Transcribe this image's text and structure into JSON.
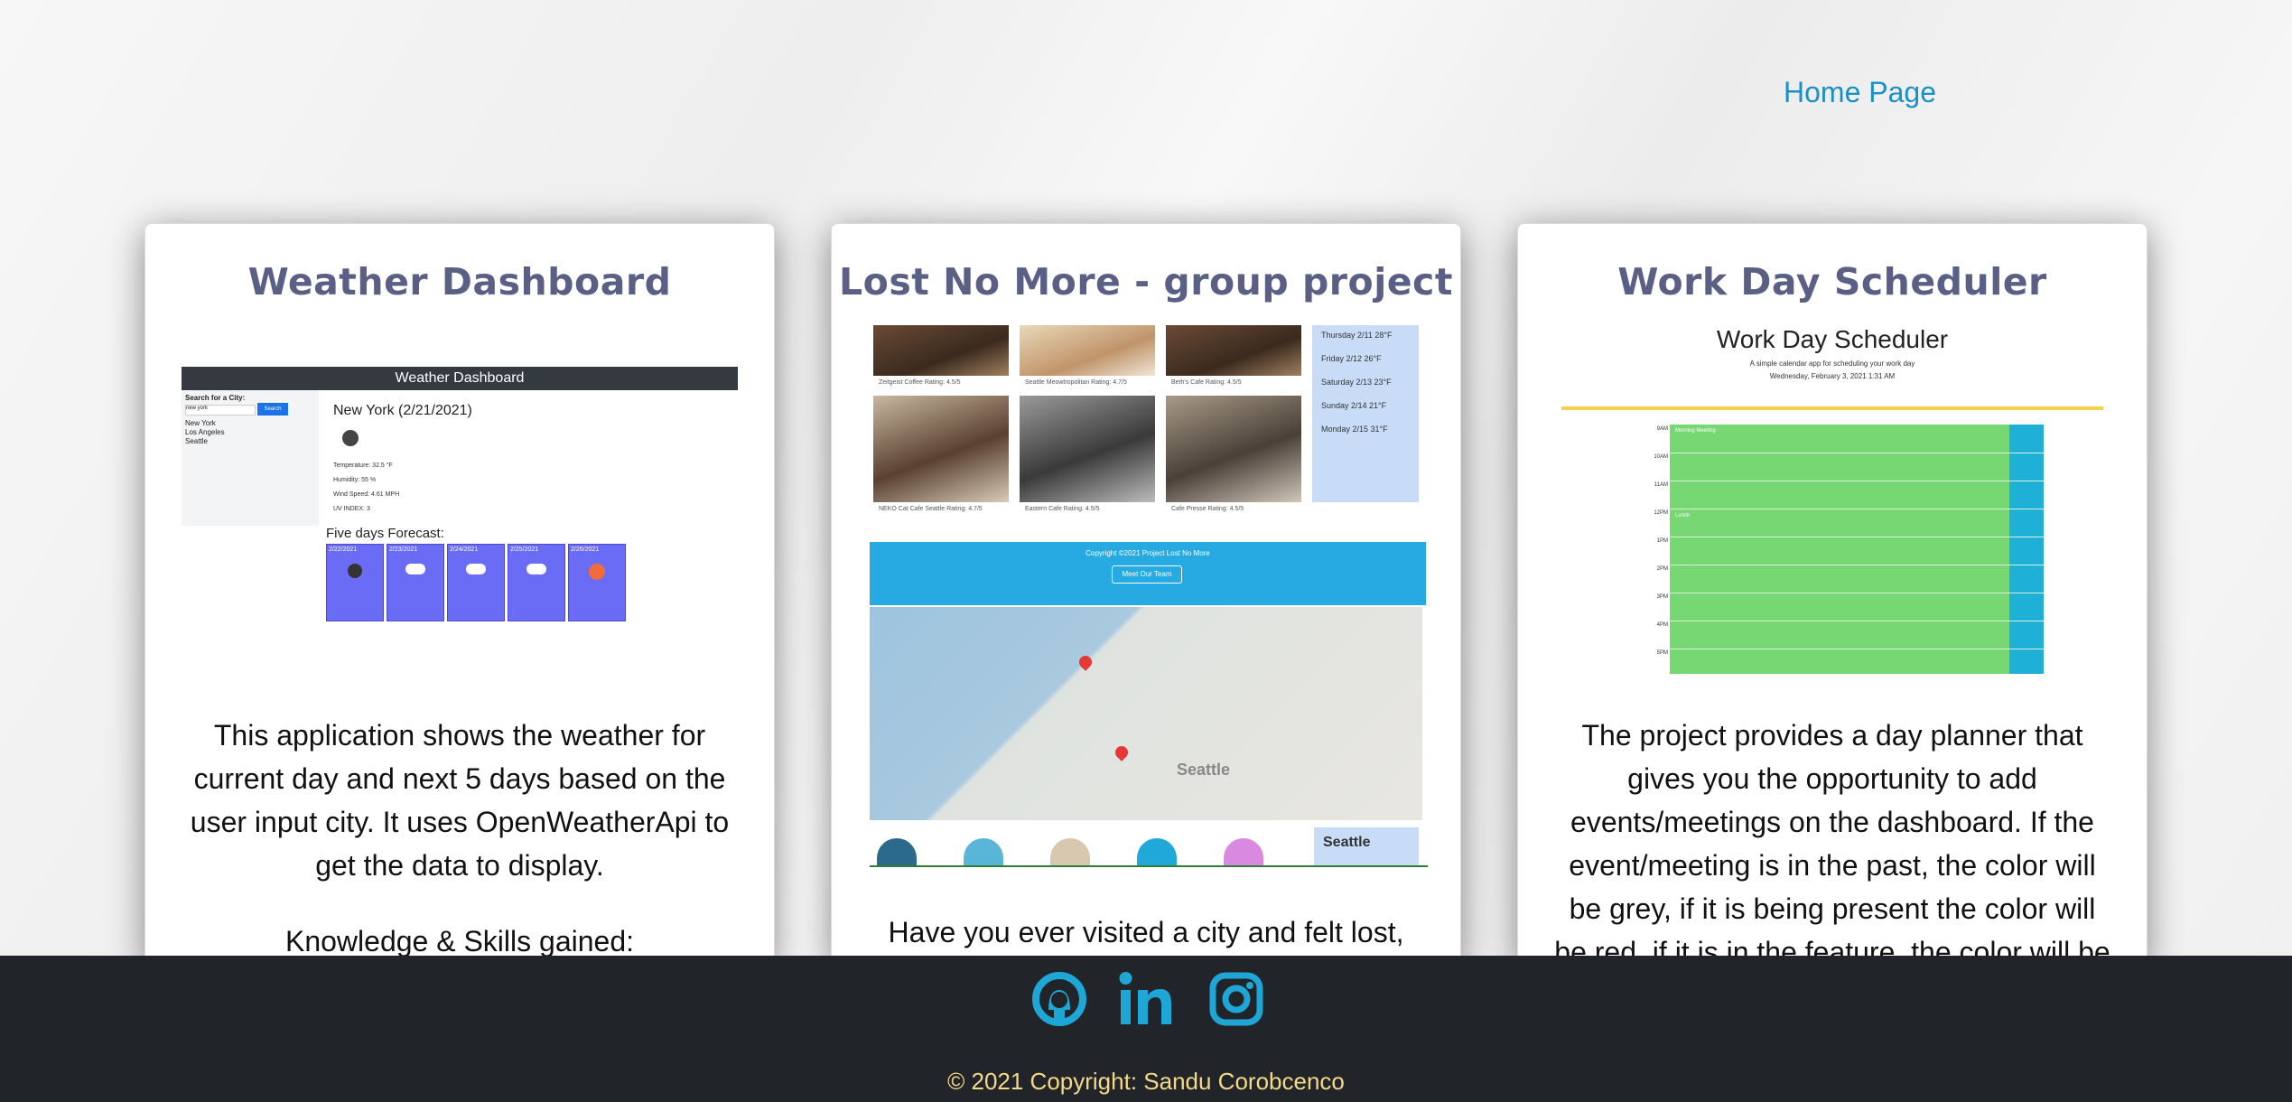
{
  "nav": {
    "home_label": "Home Page"
  },
  "cards": [
    {
      "title": "Weather Dashboard",
      "description": "This application shows the weather for current day and next 5 days based on the user input city. It uses OpenWeatherApi to get the data to display.",
      "subheading": "Knowledge & Skills gained:",
      "screenshot": {
        "header": "Weather Dashboard",
        "search_label": "Search for a City:",
        "search_value": "new york",
        "search_button": "Search",
        "cities": [
          "New York",
          "Los Angeles",
          "Seattle"
        ],
        "city_heading": "New York (2/21/2021)",
        "stats": [
          "Temperature: 32.5 °F",
          "Humidity: 55 %",
          "Wind Speed: 4.61 MPH",
          "UV INDEX: 3"
        ],
        "forecast_title": "Five days Forecast:",
        "forecast_dates": [
          "2/22/2021",
          "2/23/2021",
          "2/24/2021",
          "2/25/2021",
          "2/26/2021"
        ]
      }
    },
    {
      "title": "Lost No More - group project",
      "description": "Have you ever visited a city and felt lost,",
      "screenshot": {
        "captions": [
          "Zeitgeist Coffee   Rating: 4.5/5",
          "Seattle Meowtropolitan   Rating: 4.7/5",
          "Beth's Cafe   Rating: 4.5/5",
          "NEKO Cat Cafe Seattle   Rating: 4.7/5",
          "Eastern Cafe   Rating: 4.5/5",
          "Cafe Presse   Rating: 4.5/5"
        ],
        "forecast": [
          "Thursday 2/11   28°F",
          "Friday 2/12   26°F",
          "Saturday 2/13   23°F",
          "Sunday 2/14   21°F",
          "Monday 2/15   31°F"
        ],
        "copyright": "Copyright ©2021 Project Lost No More",
        "team_button": "Meet Our Team",
        "map_city": "Seattle",
        "city_card": "Seattle"
      }
    },
    {
      "title": "Work Day Scheduler",
      "description": "The project provides a day planner that gives you the opportunity to add events/meetings on the dashboard. If the event/meeting is in the past, the color will be grey, if it is being present the color will be red, if it is in the feature, the color will be",
      "screenshot": {
        "header": "Work Day Scheduler",
        "subtitle": "A simple calendar app for scheduling your work day",
        "date": "Wednesday, February 3, 2021 1:31 AM",
        "hours": [
          "9AM",
          "10AM",
          "11AM",
          "12PM",
          "1PM",
          "2PM",
          "3PM",
          "4PM",
          "5PM"
        ],
        "events": [
          "Morning Meeting",
          "Lunch"
        ]
      }
    }
  ],
  "footer": {
    "icons": [
      "github-icon",
      "linkedin-icon",
      "instagram-icon"
    ],
    "copyright": "© 2021 Copyright: Sandu Corobcenco"
  },
  "colors": {
    "title": "#5a5f86",
    "link": "#1a8fc9",
    "footer_bg": "#212529",
    "footer_text": "#f5d98a"
  }
}
